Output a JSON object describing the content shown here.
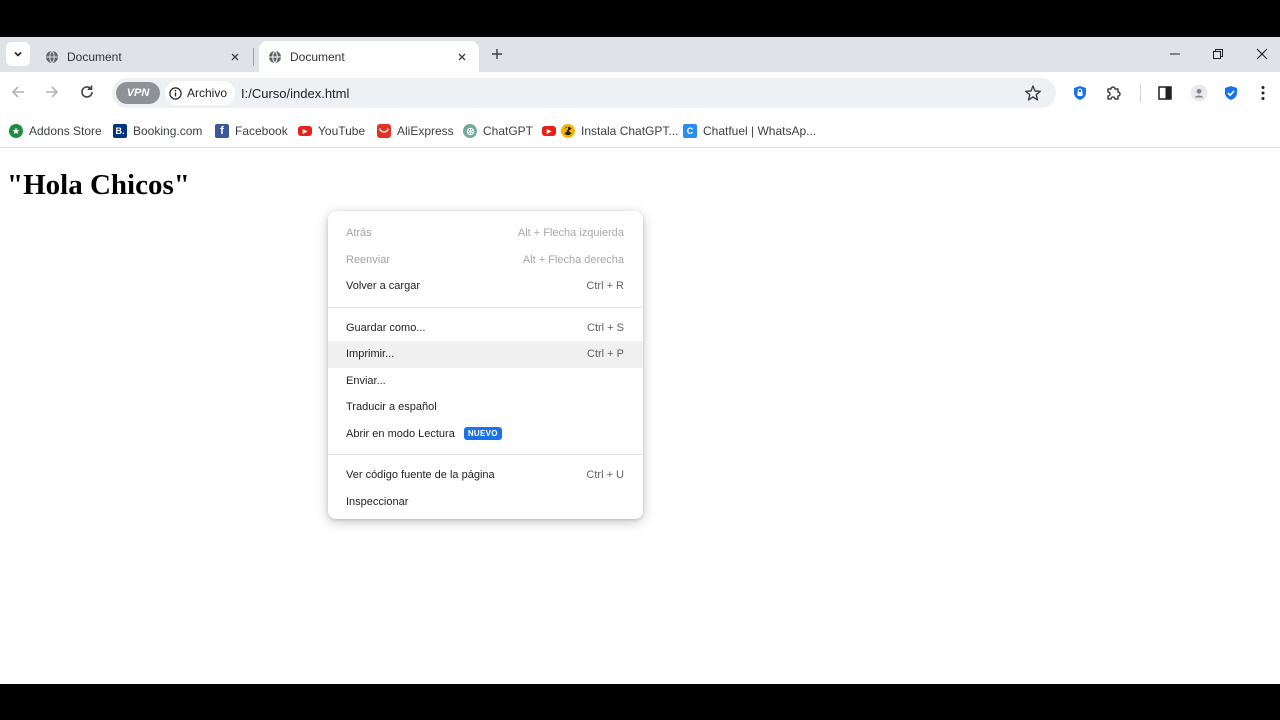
{
  "tabs": [
    {
      "title": "Document",
      "active": false
    },
    {
      "title": "Document",
      "active": true
    }
  ],
  "toolbar": {
    "vpn_label": "VPN",
    "chip_label": "Archivo",
    "url": "I:/Curso/index.html"
  },
  "bookmarks": [
    {
      "label": "Addons Store",
      "icon": "addons-store-icon",
      "color": "#1e8e3e"
    },
    {
      "label": "Booking.com",
      "icon": "booking-icon",
      "color": "#003580",
      "glyph": "B."
    },
    {
      "label": "Facebook",
      "icon": "facebook-icon",
      "color": "#3b5998",
      "glyph": "f"
    },
    {
      "label": "YouTube",
      "icon": "youtube-icon",
      "color": "#e62117",
      "glyph": "▶"
    },
    {
      "label": "AliExpress",
      "icon": "aliexpress-icon",
      "color": "#e43225",
      "glyph": "🛍"
    },
    {
      "label": "ChatGPT",
      "icon": "chatgpt-icon",
      "color": "#74aa9c",
      "glyph": "✲"
    },
    {
      "label": "Instala ChatGPT...",
      "icon": "youtube-icon",
      "color": "#e62117",
      "glyph": "▶"
    },
    {
      "label": "Chatfuel | WhatsAp...",
      "icon": "chatfuel-icon",
      "color": "#2a8bf2",
      "glyph": "C"
    }
  ],
  "page": {
    "heading": "\"Hola Chicos\""
  },
  "context_menu": {
    "groups": [
      [
        {
          "label": "Atrás",
          "shortcut": "Alt + Flecha izquierda",
          "disabled": true
        },
        {
          "label": "Reenviar",
          "shortcut": "Alt + Flecha derecha",
          "disabled": true
        },
        {
          "label": "Volver a cargar",
          "shortcut": "Ctrl + R",
          "disabled": false
        }
      ],
      [
        {
          "label": "Guardar como...",
          "shortcut": "Ctrl + S",
          "disabled": false
        },
        {
          "label": "Imprimir...",
          "shortcut": "Ctrl + P",
          "disabled": false,
          "hover": true
        },
        {
          "label": "Enviar...",
          "shortcut": "",
          "disabled": false
        },
        {
          "label": "Traducir a español",
          "shortcut": "",
          "disabled": false
        },
        {
          "label": "Abrir en modo Lectura",
          "shortcut": "",
          "disabled": false,
          "badge": "NUEVO"
        }
      ],
      [
        {
          "label": "Ver código fuente de la página",
          "shortcut": "Ctrl + U",
          "disabled": false
        },
        {
          "label": "Inspeccionar",
          "shortcut": "",
          "disabled": false
        }
      ]
    ]
  },
  "colors": {
    "tabstrip": "#dfe3e8",
    "omnibox": "#eef1f4",
    "accent": "#1a73e8"
  }
}
